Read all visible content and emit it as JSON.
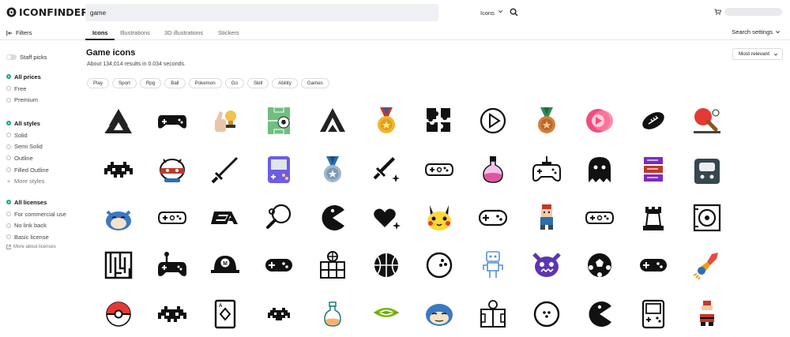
{
  "header": {
    "logo_text": "ICONFINDER",
    "search_value": "game",
    "search_type": "Icons"
  },
  "tabs": {
    "filters_label": "Filters",
    "items": [
      "Icons",
      "Illustrations",
      "3D illustrations",
      "Stickers"
    ],
    "search_settings": "Search settings"
  },
  "sidebar": {
    "staff_picks": "Staff picks",
    "prices": [
      "All prices",
      "Free",
      "Premium"
    ],
    "styles": [
      "All styles",
      "Solid",
      "Semi Solid",
      "Outline",
      "Filled Outline"
    ],
    "more_styles": "More styles",
    "licenses": [
      "All licenses",
      "For commercial use",
      "No link back",
      "Basic license"
    ],
    "more_about_licenses": "More about licenses"
  },
  "main": {
    "title": "Game icons",
    "results": "About 134,014 results in 0.034 seconds.",
    "sort": "Most relevant",
    "chips": [
      "Play",
      "Sport",
      "Rpg",
      "Ball",
      "Pokemon",
      "Go",
      "Skill",
      "Ability",
      "Games"
    ]
  },
  "colors": {
    "accent": "#21a38a",
    "search_bg": "#eef0f3",
    "border": "#e2e4e8"
  },
  "icons": [
    [
      "triforce-icon",
      "gamepad-icon",
      "thumbs-up-trophy-icon",
      "soccer-field-icon",
      "assassin-logo-icon",
      "gold-medal-icon",
      "puzzle-pieces-icon",
      "play-button-icon",
      "bronze-medal-icon",
      "pink-play-icon",
      "football-icon",
      "ping-pong-icon"
    ],
    [
      "space-invader-icon",
      "robot-mascot-icon",
      "sword-icon",
      "gameboy-icon",
      "silver-medal-icon",
      "sword-sparkle-icon",
      "controller-outline-icon",
      "potion-icon",
      "joystick-outline-icon",
      "ghost-icon",
      "book-stack-icon",
      "handheld-console-icon"
    ],
    [
      "snorlax-icon",
      "controller-outline-icon",
      "ea-logo-icon",
      "ping-pong-paddle-icon",
      "pacman-icon",
      "heart-sparkle-icon",
      "pikachu-icon",
      "controller-rounded-icon",
      "pixel-character-icon",
      "controller-outline-icon",
      "chess-rook-icon",
      "speaker-icon"
    ],
    [
      "maze-icon",
      "joystick-icon",
      "mario-cap-icon",
      "controller-solid-icon",
      "basketball-court-icon",
      "basketball-icon",
      "bowling-ball-icon",
      "robot-outline-icon",
      "monster-face-icon",
      "soccer-ball-icon",
      "controller-solid-icon",
      "fire-rocket-icon"
    ],
    [
      "pokeball-icon",
      "space-invader-icon",
      "playing-card-icon",
      "space-invader-small-icon",
      "potion-outline-icon",
      "nvidia-logo-icon",
      "snorlax-face-icon",
      "soccer-field-outline-icon",
      "bowling-ball-outline-icon",
      "pacman-icon",
      "gameboy-outline-icon",
      "pixel-santa-icon"
    ]
  ]
}
